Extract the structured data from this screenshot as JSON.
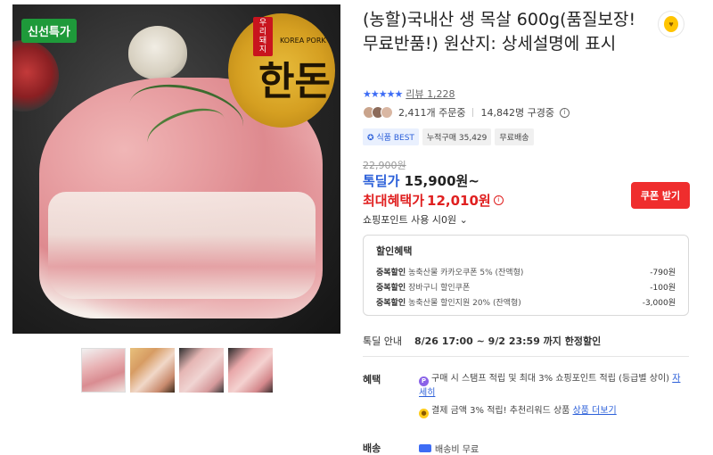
{
  "images": {
    "badge": "신선특가",
    "logo_tag": "우리돼지",
    "logo_text": "한돈",
    "logo_sub": "KOREA PORK",
    "thumbnails": [
      "thumb-1",
      "thumb-2",
      "thumb-3",
      "thumb-4"
    ]
  },
  "product": {
    "title": "(농할)국내산 생 목살 600g(품질보장!무료반품!) 원산지: 상세설명에 표시",
    "rating_stars": 4.5,
    "review_label": "리뷰",
    "review_count": "1,228",
    "orders": "2,411개 주문중",
    "viewers": "14,842명 구경중",
    "chips": [
      "식품 BEST",
      "누적구매 35,429",
      "무료배송"
    ]
  },
  "price": {
    "original": "22,900원",
    "special_label": "톡딜가",
    "special_value": "15,900원~",
    "max_label": "최대혜택가",
    "max_value": "12,010원",
    "coupon_button": "쿠폰 받기",
    "points_text": "쇼핑포인트 사용 시0원"
  },
  "discount": {
    "title": "할인혜택",
    "rows": [
      {
        "label": "중복할인",
        "desc": "농축산물 카카오쿠폰 5% (잔액형)",
        "amount": "-790원"
      },
      {
        "label": "중복할인",
        "desc": "장바구니 할인쿠폰",
        "amount": "-100원"
      },
      {
        "label": "중복할인",
        "desc": "농축산물 할인지원 20% (잔액형)",
        "amount": "-3,000원"
      }
    ]
  },
  "deal": {
    "label": "톡딜 안내",
    "value": "8/26 17:00 ~ 9/2 23:59 까지 한정할인"
  },
  "benefit": {
    "label": "혜택",
    "line1": "구매 시 스탬프 적립 및 최대 3% 쇼핑포인트 적립 (등급별 상이)",
    "line1_link": "자세히",
    "line2": "결제 금액 3% 적립! 추천리워드 상품",
    "line2_link": "상품 더보기"
  },
  "shipping": {
    "label": "배송",
    "value": "배송비 무료"
  },
  "colors": {
    "accent_blue": "#2b5fd9",
    "accent_red": "#e02020",
    "coupon_red": "#ef2d2d",
    "badge_green": "#1e9a3a"
  }
}
